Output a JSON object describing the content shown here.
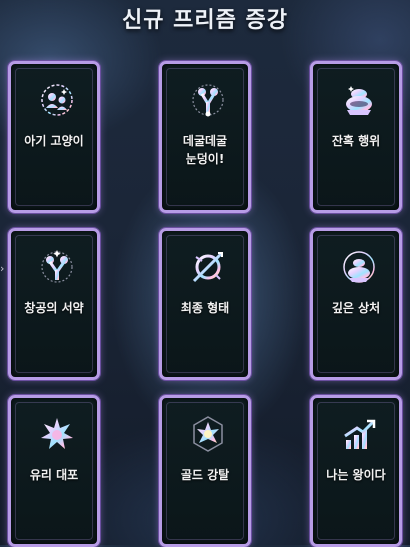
{
  "title": "신규 프리즘 증강",
  "cards": [
    {
      "label": "아기 고양이",
      "icon": "kitten-duo-icon"
    },
    {
      "label": "데굴데굴\n눈덩이!",
      "icon": "rolling-snowball-icon"
    },
    {
      "label": "잔혹 행위",
      "icon": "cauldron-icon"
    },
    {
      "label": "창공의 서약",
      "icon": "sky-oath-icon"
    },
    {
      "label": "최종 형태",
      "icon": "final-form-icon"
    },
    {
      "label": "깊은 상처",
      "icon": "deep-wound-icon"
    },
    {
      "label": "유리 대포",
      "icon": "glass-cannon-icon"
    },
    {
      "label": "골드 강탈",
      "icon": "gold-heist-icon"
    },
    {
      "label": "나는 왕이다",
      "icon": "i-am-king-icon"
    }
  ],
  "colors": {
    "card_border": "#b79ce6",
    "card_bg": "#0d1a1d",
    "prism_icon": "#e9dcff"
  }
}
